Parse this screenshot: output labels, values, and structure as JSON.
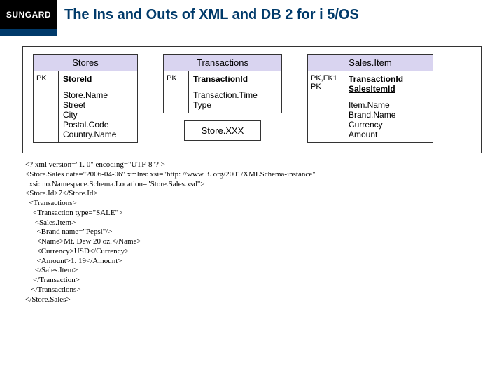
{
  "logo": "SUNGARD",
  "title": "The Ins and Outs of XML and DB 2 for i 5/OS",
  "entities": {
    "stores": {
      "title": "Stores",
      "pk_label": "PK",
      "pk_field": "StoreId",
      "fields": "Store.Name\nStreet\nCity\nPostal.Code\nCountry.Name"
    },
    "transactions": {
      "title": "Transactions",
      "pk_label": "PK",
      "pk_field": "TransactionId",
      "fields": "Transaction.Time\nType",
      "detached": "Store.XXX"
    },
    "salesitem": {
      "title": "Sales.Item",
      "pk_label": "PK,FK1\nPK",
      "pk_field": "TransactionId\nSalesItemId",
      "fields": "Item.Name\nBrand.Name\nCurrency\nAmount"
    }
  },
  "xml": "<? xml version=\"1. 0\" encoding=\"UTF-8\"? >\n<Store.Sales date=\"2006-04-06\" xmlns: xsi=\"http: //www 3. org/2001/XMLSchema-instance\"\n  xsi: no.Namespace.Schema.Location=\"Store.Sales.xsd\">\n<Store.Id>7</Store.Id>\n  <Transactions>\n    <Transaction type=\"SALE\">\n     <Sales.Item>\n      <Brand name=\"Pepsi\"/>\n      <Name>Mt. Dew 20 oz.</Name>\n      <Currency>USD</Currency>\n      <Amount>1. 19</Amount>\n     </Sales.Item>\n    </Transaction>\n   </Transactions>\n</Store.Sales>"
}
